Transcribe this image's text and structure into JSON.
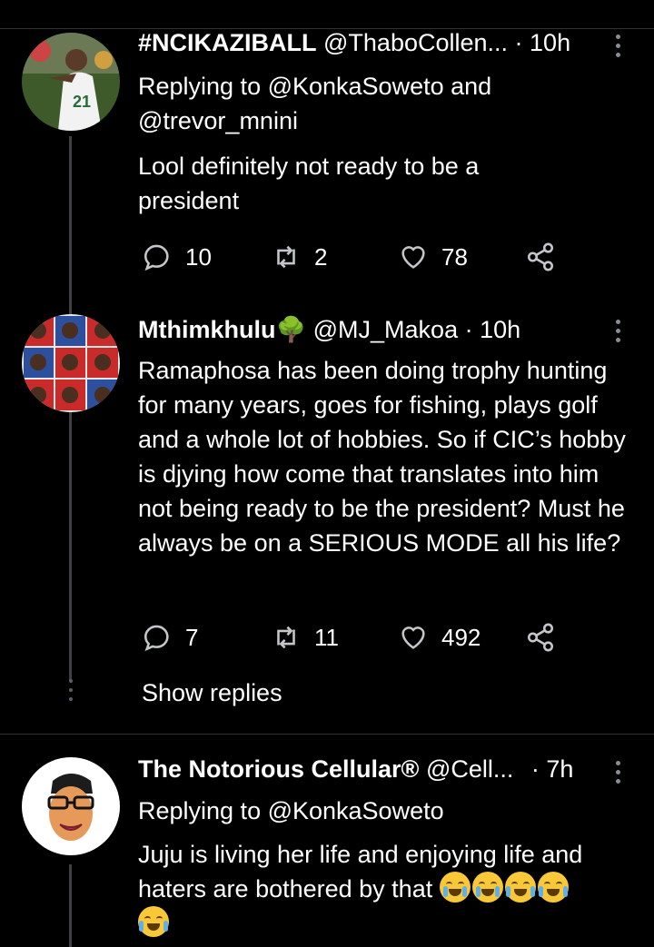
{
  "tweets": [
    {
      "name": "#NCIKAZIBALL",
      "handle": "@ThaboCollen...",
      "time": "· 10h",
      "reply_to": "Replying to @KonkaSoweto and @trevor_mnini",
      "text": "Lool definitely not ready to be a president",
      "replies": "10",
      "retweets": "2",
      "likes": "78"
    },
    {
      "name": "Mthimkhulu🌳",
      "handle": "@MJ_Makoa",
      "time": "· 10h",
      "text": "Ramaphosa has been doing trophy hunting for many years, goes for fishing, plays golf and a whole lot of hobbies. So if CIC’s hobby is djying how come that translates into him not being ready to be the president?  Must he always be on a SERIOUS MODE all his life?",
      "replies": "7",
      "retweets": "11",
      "likes": "492"
    },
    {
      "name": "The Notorious Cellular®",
      "handle": "@Cell...",
      "time": "· 7h",
      "reply_to": "Replying to @KonkaSoweto",
      "text_line1": "Juju is living her life and enjoying life and",
      "text_line2": "haters are bothered by that",
      "emojis": "😭😭😂😂😂"
    }
  ],
  "show_replies_label": "Show replies",
  "colors": {
    "background": "#000000",
    "text": "#ffffff",
    "muted": "#8b8f93",
    "line": "#3e4144"
  },
  "icons": [
    "reply-icon",
    "retweet-icon",
    "like-icon",
    "share-icon",
    "more-icon"
  ]
}
